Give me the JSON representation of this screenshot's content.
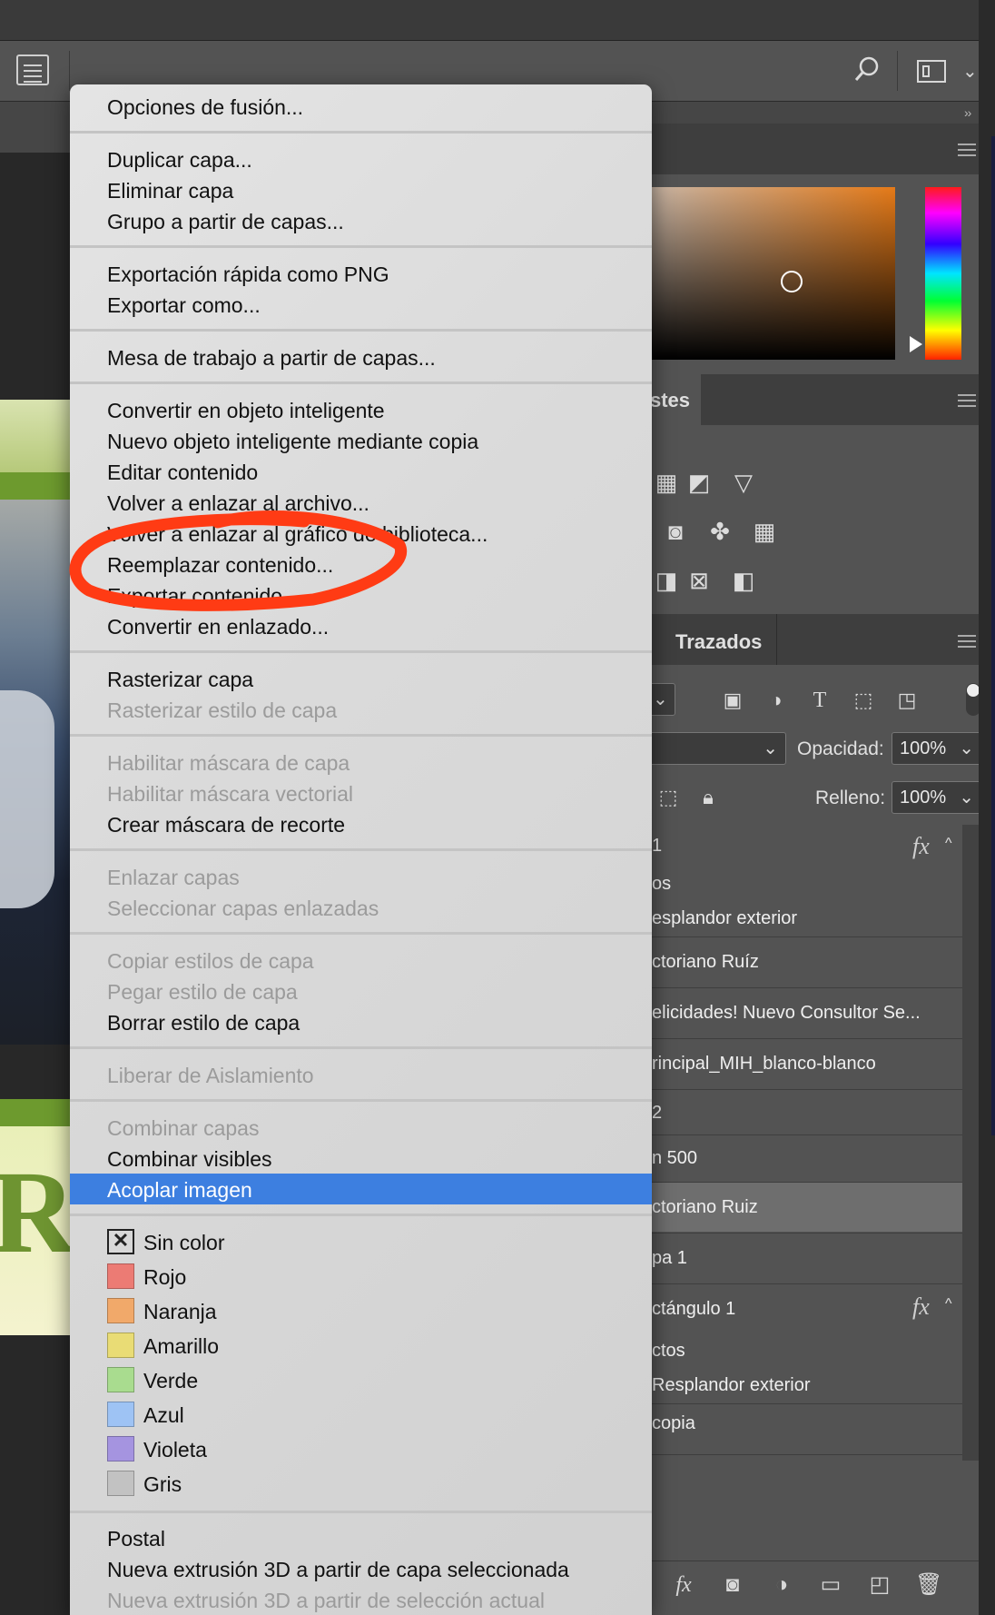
{
  "panels": {
    "adjustments_tab": "stes",
    "paths_tab": "Trazados",
    "opacity_label": "Opacidad:",
    "opacity_value": "100%",
    "fill_label": "Relleno:",
    "fill_value": "100%"
  },
  "layers": [
    {
      "name": "1",
      "fx": true
    },
    {
      "name": "os",
      "fx": false
    },
    {
      "name": "esplandor exterior",
      "fx": false
    },
    {
      "name": "ctoriano Ruíz",
      "fx": false
    },
    {
      "name": "elicidades! Nuevo Consultor Se...",
      "fx": false
    },
    {
      "name": "rincipal_MIH_blanco-blanco",
      "fx": false
    },
    {
      "name": "2",
      "fx": false
    },
    {
      "name": "n 500",
      "fx": false
    },
    {
      "name": "ctoriano Ruiz",
      "fx": false,
      "selected": true
    },
    {
      "name": "pa 1",
      "fx": false
    },
    {
      "name": "ctángulo 1",
      "fx": true
    },
    {
      "name": "ctos",
      "fx": false
    },
    {
      "name": "Resplandor exterior",
      "fx": false
    },
    {
      "name": "copia",
      "fx": false
    }
  ],
  "layer_fx_label": "fx",
  "context_menu": {
    "items": [
      {
        "label": "Opciones de fusión...",
        "enabled": true
      },
      {
        "label": "Duplicar capa...",
        "enabled": true
      },
      {
        "label": "Eliminar capa",
        "enabled": true
      },
      {
        "label": "Grupo a partir de capas...",
        "enabled": true
      },
      {
        "label": "Exportación rápida como PNG",
        "enabled": true
      },
      {
        "label": "Exportar como...",
        "enabled": true
      },
      {
        "label": "Mesa de trabajo a partir de capas...",
        "enabled": true
      },
      {
        "label": "Convertir en objeto inteligente",
        "enabled": true
      },
      {
        "label": "Nuevo objeto inteligente mediante copia",
        "enabled": true
      },
      {
        "label": "Editar contenido",
        "enabled": true
      },
      {
        "label": "Volver a enlazar al archivo...",
        "enabled": true
      },
      {
        "label": "Volver a enlazar al gráfico de biblioteca...",
        "enabled": true
      },
      {
        "label": "Reemplazar contenido...",
        "enabled": true
      },
      {
        "label": "Exportar contenido...",
        "enabled": true
      },
      {
        "label": "Convertir en enlazado...",
        "enabled": true
      },
      {
        "label": "Rasterizar capa",
        "enabled": true
      },
      {
        "label": "Rasterizar estilo de capa",
        "enabled": false
      },
      {
        "label": "Habilitar máscara de capa",
        "enabled": false
      },
      {
        "label": "Habilitar máscara vectorial",
        "enabled": false
      },
      {
        "label": "Crear máscara de recorte",
        "enabled": true
      },
      {
        "label": "Enlazar capas",
        "enabled": false
      },
      {
        "label": "Seleccionar capas enlazadas",
        "enabled": false
      },
      {
        "label": "Copiar estilos de capa",
        "enabled": false
      },
      {
        "label": "Pegar estilo de capa",
        "enabled": false
      },
      {
        "label": "Borrar estilo de capa",
        "enabled": true
      },
      {
        "label": "Liberar de Aislamiento",
        "enabled": false
      },
      {
        "label": "Combinar capas",
        "enabled": false
      },
      {
        "label": "Combinar visibles",
        "enabled": true
      },
      {
        "label": "Acoplar imagen",
        "enabled": true,
        "highlighted": true
      }
    ],
    "colors": [
      {
        "label": "Sin color",
        "swatch": "none"
      },
      {
        "label": "Rojo",
        "swatch": "#ec7b74"
      },
      {
        "label": "Naranja",
        "swatch": "#f1a96a"
      },
      {
        "label": "Amarillo",
        "swatch": "#e9dc75"
      },
      {
        "label": "Verde",
        "swatch": "#a9dc8f"
      },
      {
        "label": "Azul",
        "swatch": "#9ec3f4"
      },
      {
        "label": "Violeta",
        "swatch": "#a594e0"
      },
      {
        "label": "Gris",
        "swatch": "#c2c2c2"
      }
    ],
    "bottom_items": [
      {
        "label": "Postal",
        "enabled": true
      },
      {
        "label": "Nueva extrusión 3D a partir de capa seleccionada",
        "enabled": true
      },
      {
        "label": "Nueva extrusión 3D a partir de selección actual",
        "enabled": false
      }
    ]
  },
  "annotation": {
    "color": "#ff3b14",
    "target": "Reemplazar contenido..."
  },
  "canvas_text": "R",
  "icons": [
    "document-icon",
    "search-icon",
    "workspace-icon",
    "chevron-down-icon",
    "panel-menu-icon",
    "camera-icon",
    "type-icon",
    "lock-icon",
    "fx-icon",
    "mask-icon",
    "folder-icon",
    "new-layer-icon",
    "trash-icon"
  ]
}
